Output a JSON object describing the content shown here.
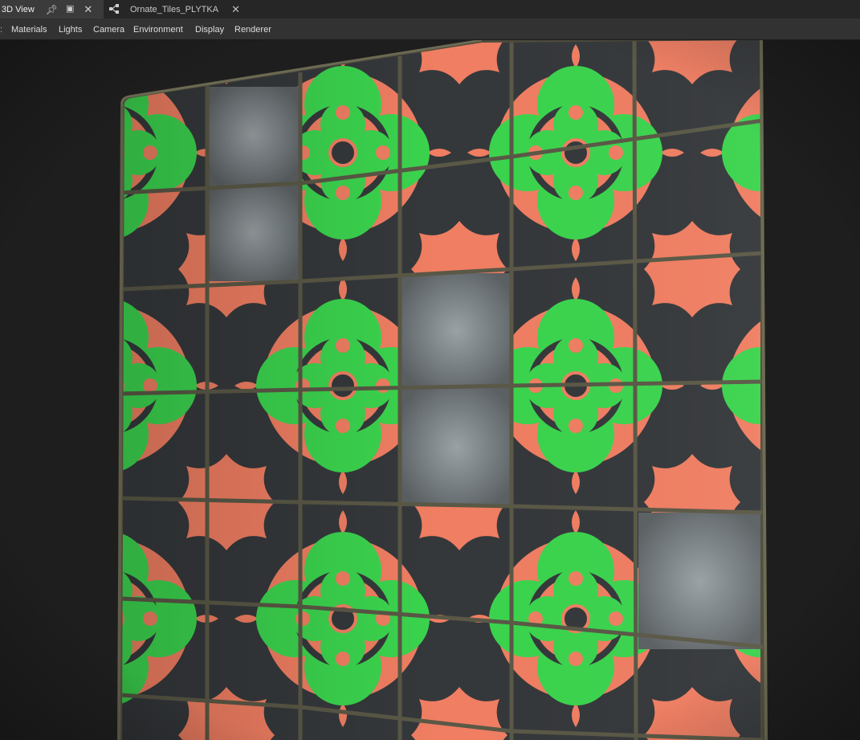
{
  "tabs": [
    {
      "label": "3D View",
      "active": true
    },
    {
      "label": "Ornate_Tiles_PLYTKA",
      "active": false
    }
  ],
  "menu": {
    "items": [
      "Materials",
      "Lights",
      "Camera",
      "Environment",
      "Display",
      "Renderer"
    ]
  },
  "viewport": {
    "object": "textured tile panel",
    "tile_colors": {
      "green": "#3bd44e",
      "coral": "#f07e62",
      "base": "#3a3d40",
      "damaged": "#7e8588",
      "grout": "#4d4b3c"
    }
  },
  "icons": {
    "pin": "pin-icon",
    "float": "float-window-icon",
    "close": "close-icon",
    "graph": "graph-icon"
  }
}
